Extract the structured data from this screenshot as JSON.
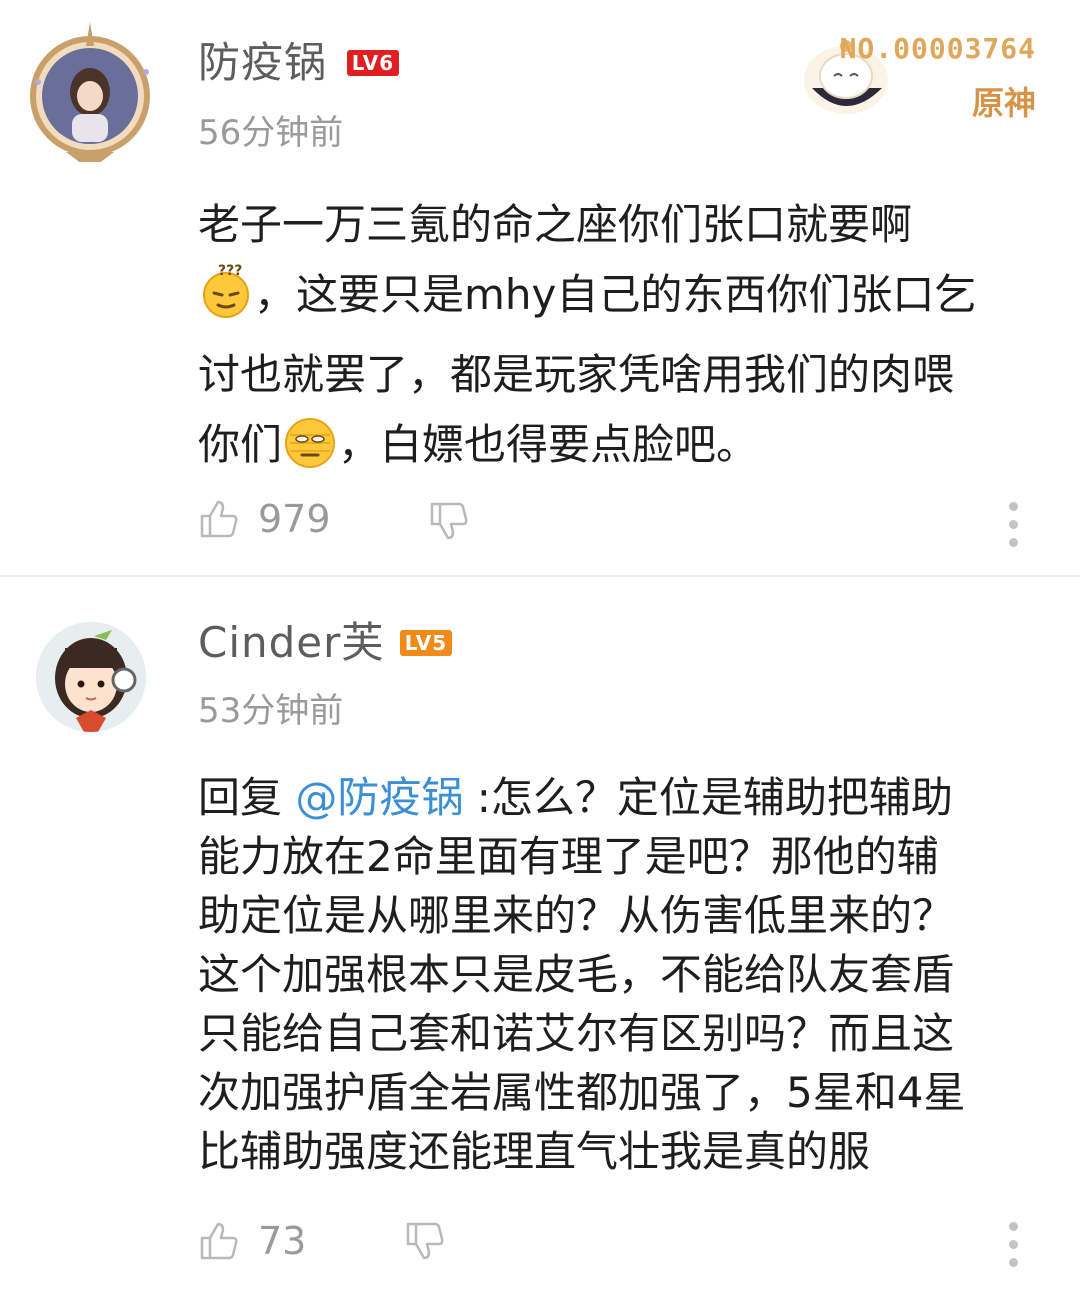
{
  "comments": [
    {
      "username": "防疫锅",
      "level": "LV6",
      "time": "56分钟前",
      "lines": [
        "老子一万三氪的命之座你们张口就要啊",
        "，这要只是mhy自己的东西你们张口乞",
        "讨也就罢了，都是玩家凭啥用我们的肉喂",
        "你们",
        "，白嫖也得要点脸吧。"
      ],
      "likes": "979",
      "badge": {
        "number": "NO.00003764",
        "game": "原神"
      }
    },
    {
      "username": "Cinder芙",
      "level": "LV5",
      "time": "53分钟前",
      "reply_prefix": "回复 ",
      "mention": "@防疫锅",
      "lines": [
        " :怎么？定位是辅助把辅助",
        "能力放在2命里面有理了是吧？那他的辅",
        "助定位是从哪里来的？从伤害低里来的？",
        "这个加强根本只是皮毛，不能给队友套盾",
        "只能给自己套和诺艾尔有区别吗？而且这",
        "次加强护盾全岩属性都加强了，5星和4星",
        "比辅助强度还能理直气壮我是真的服"
      ],
      "likes": "73"
    }
  ],
  "colors": {
    "lv6": "#e02020",
    "lv5": "#f08a18",
    "mention": "#3a8fd6",
    "meta": "#9a9a9a"
  }
}
